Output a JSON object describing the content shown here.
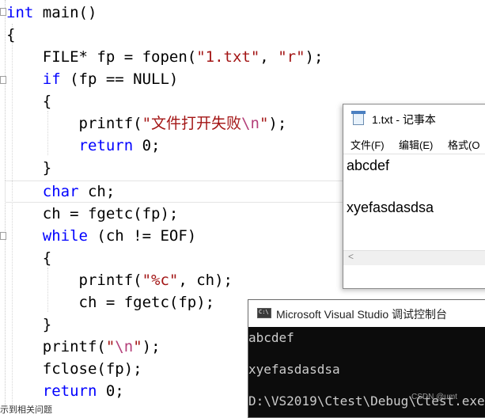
{
  "editor": {
    "lines": [
      {
        "parts": [
          {
            "t": "int",
            "c": "kw"
          },
          {
            "t": " main()",
            "c": ""
          }
        ]
      },
      {
        "parts": [
          {
            "t": "{",
            "c": ""
          }
        ]
      },
      {
        "parts": [
          {
            "t": "    FILE* fp = fopen(",
            "c": ""
          },
          {
            "t": "\"1.txt\"",
            "c": "str"
          },
          {
            "t": ", ",
            "c": ""
          },
          {
            "t": "\"r\"",
            "c": "str"
          },
          {
            "t": ");",
            "c": ""
          }
        ]
      },
      {
        "parts": [
          {
            "t": "    ",
            "c": ""
          },
          {
            "t": "if",
            "c": "kw"
          },
          {
            "t": " (fp == NULL)",
            "c": ""
          }
        ]
      },
      {
        "parts": [
          {
            "t": "    {",
            "c": ""
          }
        ]
      },
      {
        "parts": [
          {
            "t": "        printf(",
            "c": ""
          },
          {
            "t": "\"文件打开失败",
            "c": "str"
          },
          {
            "t": "\\n",
            "c": "esc"
          },
          {
            "t": "\"",
            "c": "str"
          },
          {
            "t": ");",
            "c": ""
          }
        ]
      },
      {
        "parts": [
          {
            "t": "        ",
            "c": ""
          },
          {
            "t": "return",
            "c": "kw"
          },
          {
            "t": " 0;",
            "c": ""
          }
        ]
      },
      {
        "parts": [
          {
            "t": "    }",
            "c": ""
          }
        ]
      },
      {
        "parts": [
          {
            "t": "    ",
            "c": ""
          },
          {
            "t": "char",
            "c": "kw"
          },
          {
            "t": " ch;",
            "c": ""
          }
        ]
      },
      {
        "parts": [
          {
            "t": "    ch = fgetc(fp);",
            "c": ""
          }
        ]
      },
      {
        "parts": [
          {
            "t": "    ",
            "c": ""
          },
          {
            "t": "while",
            "c": "kw"
          },
          {
            "t": " (ch != EOF)",
            "c": ""
          }
        ]
      },
      {
        "parts": [
          {
            "t": "    {",
            "c": ""
          }
        ]
      },
      {
        "parts": [
          {
            "t": "        printf(",
            "c": ""
          },
          {
            "t": "\"%c\"",
            "c": "str"
          },
          {
            "t": ", ch);",
            "c": ""
          }
        ]
      },
      {
        "parts": [
          {
            "t": "        ch = fgetc(fp);",
            "c": ""
          }
        ]
      },
      {
        "parts": [
          {
            "t": "    }",
            "c": ""
          }
        ]
      },
      {
        "parts": [
          {
            "t": "    printf(",
            "c": ""
          },
          {
            "t": "\"",
            "c": "str"
          },
          {
            "t": "\\n",
            "c": "esc"
          },
          {
            "t": "\"",
            "c": "str"
          },
          {
            "t": ");",
            "c": ""
          }
        ]
      },
      {
        "parts": [
          {
            "t": "    fclose(fp);",
            "c": ""
          }
        ]
      },
      {
        "parts": [
          {
            "t": "    ",
            "c": ""
          },
          {
            "t": "return",
            "c": "kw"
          },
          {
            "t": " 0;",
            "c": ""
          }
        ]
      }
    ]
  },
  "notepad": {
    "title": "1.txt - 记事本",
    "menu": [
      "文件(F)",
      "编辑(E)",
      "格式(O"
    ],
    "content_line1": "abcdef",
    "content_line2": "xyefasdasdsa"
  },
  "console": {
    "title": "Microsoft Visual Studio 调试控制台",
    "line1": "abcdef",
    "line2": "xyefasdasdsa",
    "line3": "D:\\VS2019\\Ctest\\Debug\\Ctest.exe"
  },
  "watermark": "CSDN @umt",
  "bottom_text": "示到相关问题"
}
